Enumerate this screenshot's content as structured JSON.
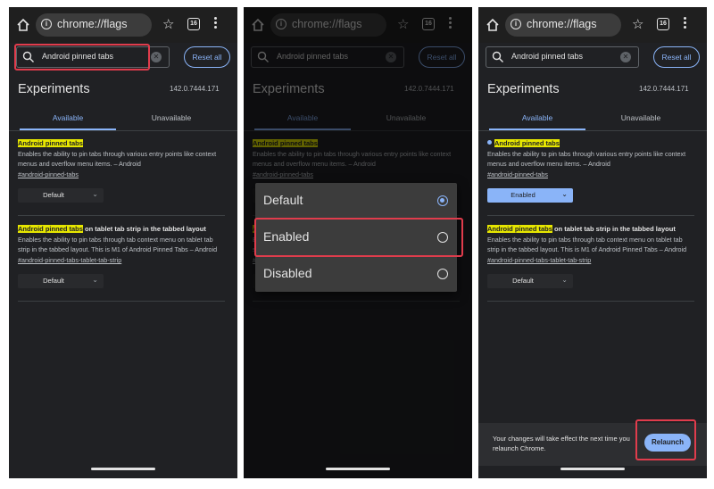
{
  "browser": {
    "url": "chrome://flags",
    "tab_count": "16"
  },
  "search": {
    "query": "Android pinned tabs",
    "reset_label": "Reset all"
  },
  "page": {
    "title": "Experiments",
    "version": "142.0.7444.171",
    "tab_available": "Available",
    "tab_unavailable": "Unavailable"
  },
  "flags": [
    {
      "title_highlight": "Android pinned tabs",
      "title_rest": "",
      "description": "Enables the ability to pin tabs through various entry points like context menus and overflow menu items. – Android",
      "link": "#android-pinned-tabs",
      "value": "Default"
    },
    {
      "title_highlight": "Android pinned tabs",
      "title_rest": " on tablet tab strip in the tabbed layout",
      "description": "Enables the ability to pin tabs through tab context menu on tablet tab strip in the tabbed layout. This is M1 of Android Pinned Tabs – Android",
      "link": "#android-pinned-tabs-tablet-tab-strip",
      "value": "Default"
    }
  ],
  "flag1_enabled_value": "Enabled",
  "dialog": {
    "options": [
      {
        "label": "Default",
        "selected": true
      },
      {
        "label": "Enabled",
        "selected": false
      },
      {
        "label": "Disabled",
        "selected": false
      }
    ]
  },
  "snackbar": {
    "message": "Your changes will take effect the next time you relaunch Chrome.",
    "button": "Relaunch"
  },
  "colors": {
    "background": "#202124",
    "accent": "#8ab4f8",
    "highlight": "#e6e600",
    "annotation_box": "#e03c4c"
  },
  "icons": [
    "home-icon",
    "info-icon",
    "star-icon",
    "tab-switcher-icon",
    "overflow-menu-icon",
    "search-icon",
    "clear-icon"
  ]
}
